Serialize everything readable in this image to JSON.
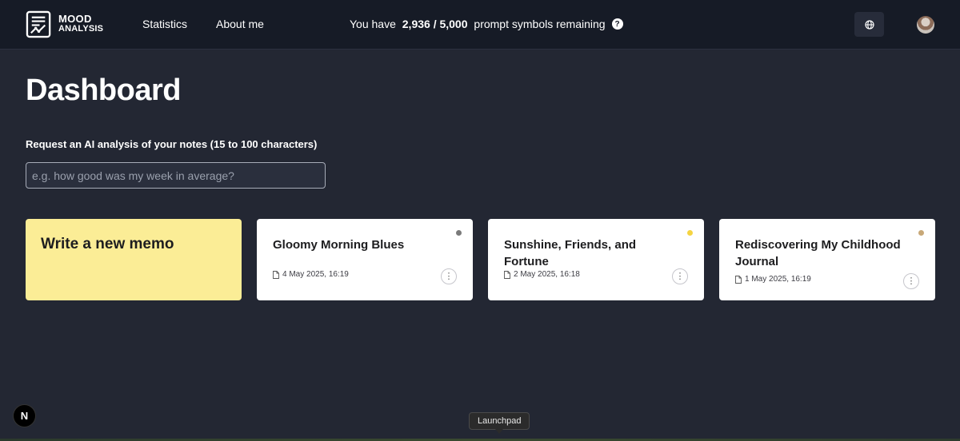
{
  "header": {
    "logo_line1": "MOOD",
    "logo_line2": "ANALYSIS",
    "nav": [
      {
        "label": "Statistics"
      },
      {
        "label": "About me"
      }
    ],
    "quota_prefix": "You have ",
    "quota_used": "2,936 / 5,000",
    "quota_suffix": " prompt symbols remaining",
    "help_glyph": "?"
  },
  "main": {
    "title": "Dashboard",
    "ai_label": "Request an AI analysis of your notes (15 to 100 characters)",
    "ai_placeholder": "e.g. how good was my week in average?",
    "new_memo_label": "Write a new memo",
    "memos": [
      {
        "title": "Gloomy Morning Blues",
        "date": "4 May 2025, 16:19",
        "mood_color": "#7a7a7a"
      },
      {
        "title": "Sunshine, Friends, and Fortune",
        "date": "2 May 2025, 16:18",
        "mood_color": "#f5d442"
      },
      {
        "title": "Rediscovering My Childhood Journal",
        "date": "1 May 2025, 16:19",
        "mood_color": "#c8a878"
      }
    ],
    "more_glyph": "⋮"
  },
  "footer": {
    "next_badge": "N",
    "tooltip": "Launchpad"
  },
  "colors": {
    "background": "#232733",
    "header": "#161b26",
    "new_memo_card": "#fbed96",
    "card": "#ffffff"
  }
}
